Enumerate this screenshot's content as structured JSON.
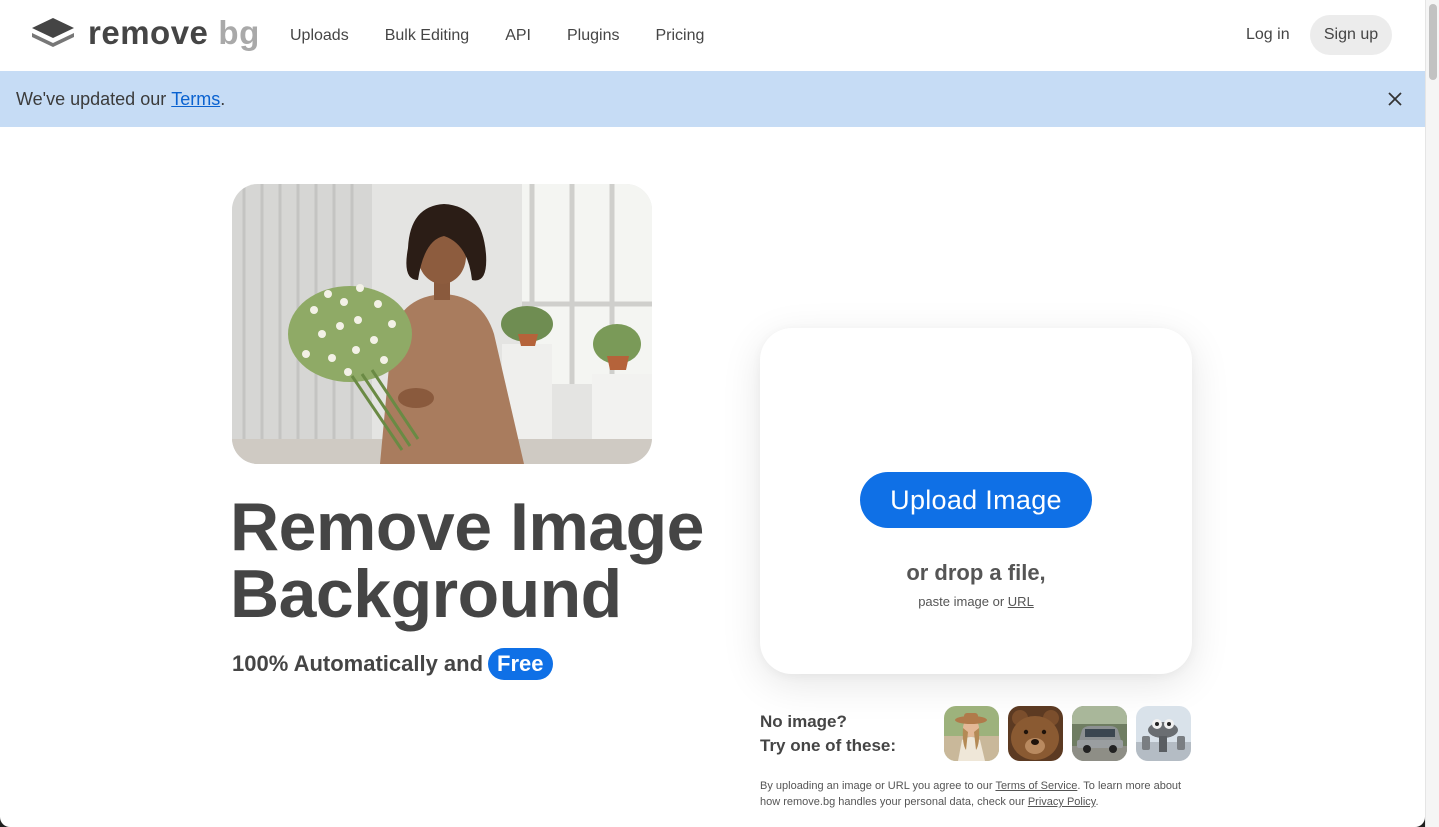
{
  "logo": {
    "word1": "remove",
    "word2": "bg"
  },
  "nav": [
    "Uploads",
    "Bulk Editing",
    "API",
    "Plugins",
    "Pricing"
  ],
  "auth": {
    "login": "Log in",
    "signup": "Sign up"
  },
  "banner": {
    "text_before": "We've updated our ",
    "link": "Terms",
    "text_after": "."
  },
  "hero": {
    "line1": "Remove Image",
    "line2": "Background",
    "sub_text": "100% Automatically and",
    "badge": "Free"
  },
  "upload": {
    "button": "Upload Image",
    "drop_text": "or drop a file,",
    "paste_text": "paste image or ",
    "paste_link": "URL"
  },
  "samples": {
    "line1": "No image?",
    "line2": "Try one of these:",
    "items": [
      "woman-with-hat",
      "bear",
      "car",
      "figurine"
    ]
  },
  "legal": {
    "part1": "By uploading an image or URL you agree to our ",
    "tos_link": "Terms of Service",
    "part2": ". To learn more about how remove.bg handles your personal data, check our ",
    "privacy_link": "Privacy Policy",
    "part3": "."
  },
  "colors": {
    "accent": "#0f70e6",
    "banner_bg": "#c6dcf5",
    "text": "#454545"
  }
}
